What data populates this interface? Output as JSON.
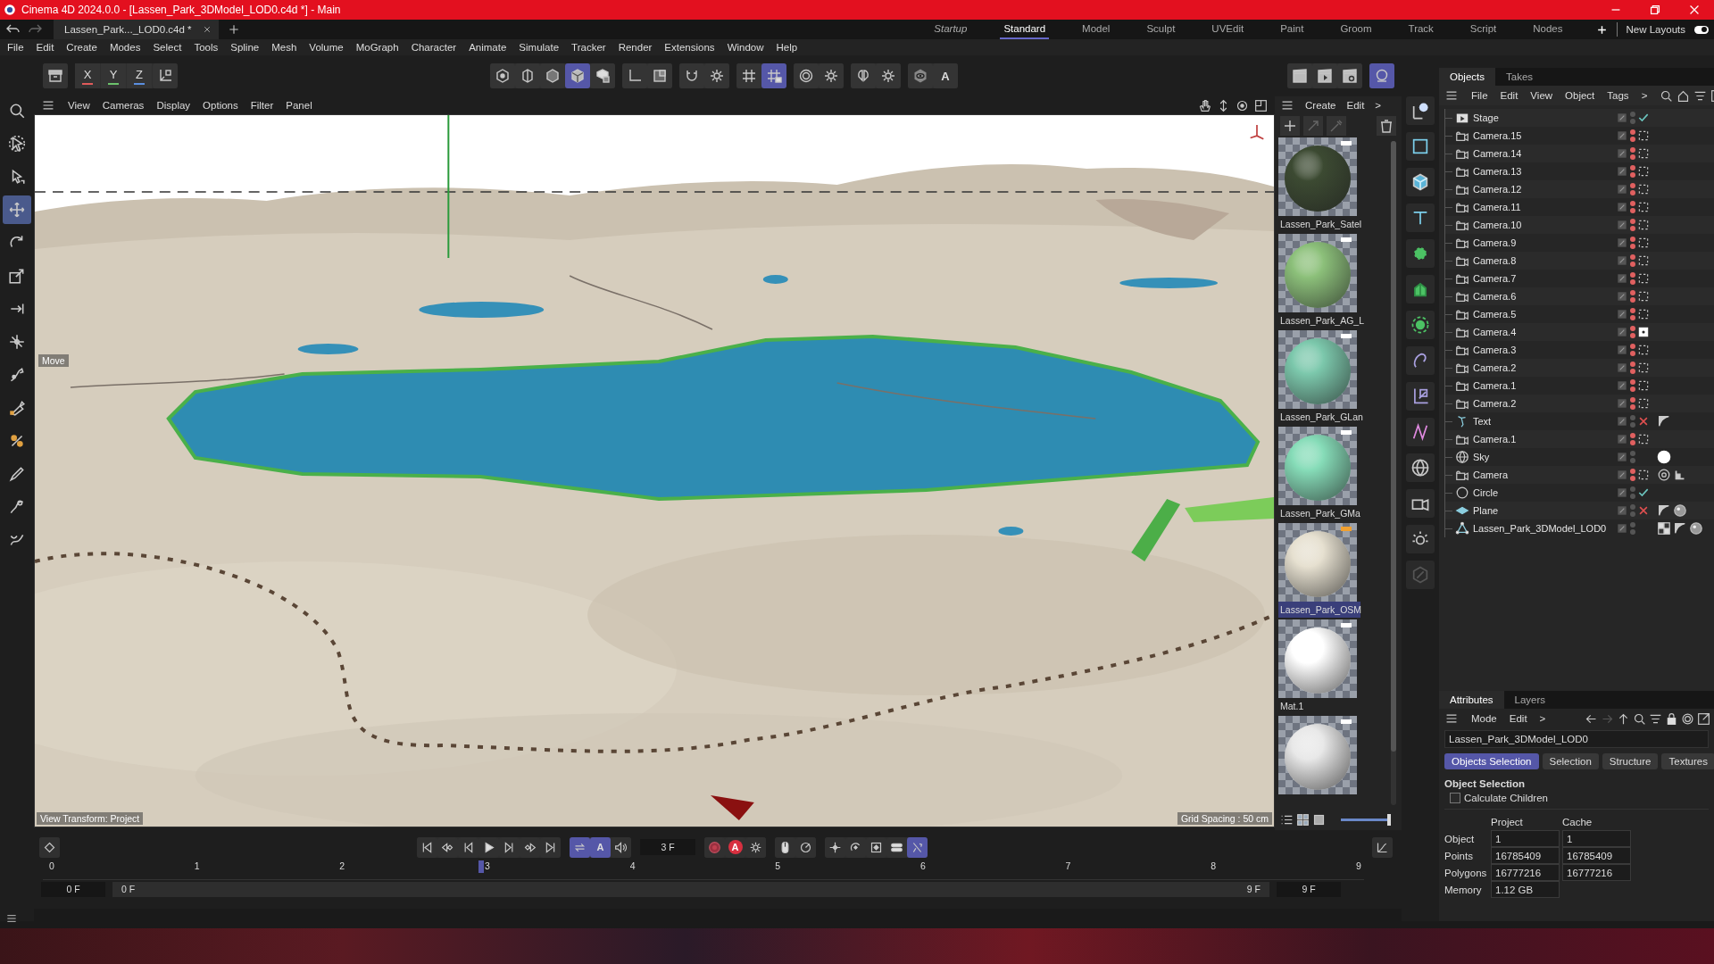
{
  "window": {
    "title": "Cinema 4D 2024.0.0 - [Lassen_Park_3DModel_LOD0.c4d *] - Main"
  },
  "document_tabs": [
    {
      "label": "Lassen_Park..._LOD0.c4d *",
      "selected": true
    }
  ],
  "layout_tabs": [
    {
      "label": "Startup",
      "kind": "startup",
      "selected": false
    },
    {
      "label": "Standard",
      "kind": "layout",
      "selected": true
    },
    {
      "label": "Model",
      "kind": "layout",
      "selected": false
    },
    {
      "label": "Sculpt",
      "kind": "layout",
      "selected": false
    },
    {
      "label": "UVEdit",
      "kind": "layout",
      "selected": false
    },
    {
      "label": "Paint",
      "kind": "layout",
      "selected": false
    },
    {
      "label": "Groom",
      "kind": "layout",
      "selected": false
    },
    {
      "label": "Track",
      "kind": "layout",
      "selected": false
    },
    {
      "label": "Script",
      "kind": "layout",
      "selected": false
    },
    {
      "label": "Nodes",
      "kind": "layout",
      "selected": false
    }
  ],
  "new_layouts": {
    "label": "New Layouts",
    "on": true
  },
  "menu": [
    "File",
    "Edit",
    "Create",
    "Modes",
    "Select",
    "Tools",
    "Spline",
    "Mesh",
    "Volume",
    "MoGraph",
    "Character",
    "Animate",
    "Simulate",
    "Tracker",
    "Render",
    "Extensions",
    "Window",
    "Help"
  ],
  "toolbar": {
    "axes": [
      {
        "label": "X",
        "color": "#e05a5a"
      },
      {
        "label": "Y",
        "color": "#6cc26c"
      },
      {
        "label": "Z",
        "color": "#5a8ee0"
      }
    ],
    "buttons": [
      {
        "active": false
      },
      {
        "active": false
      },
      {
        "active": false
      },
      {
        "active": false
      },
      {
        "active": false
      },
      {
        "active": true
      },
      {
        "active": false
      },
      {
        "active": false
      },
      {
        "active": false
      },
      {
        "active": false
      },
      {
        "active": false
      },
      {
        "active": false
      },
      {
        "active": true
      },
      {
        "active": false
      },
      {
        "active": false
      },
      {
        "active": false
      },
      {
        "active": false
      },
      {
        "active": false
      },
      {
        "active": false,
        "label": "A"
      },
      {
        "active": false
      },
      {
        "active": false
      },
      {
        "active": false
      },
      {
        "active": true
      }
    ]
  },
  "tools": [
    {
      "active": false
    },
    {
      "active": false
    },
    {
      "active": false
    },
    {
      "active": true
    },
    {
      "active": false
    },
    {
      "active": false
    },
    {
      "active": false
    },
    {
      "active": false
    },
    {
      "active": false
    },
    {
      "active": false
    },
    {
      "active": false
    },
    {
      "active": false
    },
    {
      "active": false
    },
    {
      "active": false
    }
  ],
  "viewport": {
    "menu": [
      "View",
      "Cameras",
      "Display",
      "Options",
      "Filter",
      "Panel"
    ],
    "tool_label": "Move",
    "view_transform": "View Transform: Project",
    "grid_spacing": "Grid Spacing : 50 cm"
  },
  "materials": {
    "menu": [
      "Create",
      "Edit",
      ">"
    ],
    "items": [
      {
        "name": "Lassen_Park_Satel",
        "color": "#3c4a32",
        "selected": false
      },
      {
        "name": "Lassen_Park_AG_L",
        "color": "#8cc07a",
        "selected": false
      },
      {
        "name": "Lassen_Park_GLan",
        "color": "#7cc8ac",
        "selected": false
      },
      {
        "name": "Lassen_Park_GMa",
        "color": "#86dcb8",
        "selected": false
      },
      {
        "name": "Lassen_Park_OSM",
        "color": "#e6e0d0",
        "selected": true
      },
      {
        "name": "Mat.1",
        "color": "#ffffff",
        "selected": false
      },
      {
        "color": "#e8e8e8",
        "selected": false
      }
    ],
    "zoom_slider": {
      "level": 1
    }
  },
  "objects": {
    "tabs": [
      {
        "label": "Objects",
        "selected": true
      },
      {
        "label": "Takes",
        "selected": false
      }
    ],
    "menu": [
      "File",
      "Edit",
      "View",
      "Object",
      "Tags",
      ">"
    ],
    "items": [
      {
        "name": "Stage",
        "kind": "stage",
        "hidden": false,
        "enabled": true
      },
      {
        "name": "Camera.15",
        "kind": "camera",
        "hidden": true,
        "active": false
      },
      {
        "name": "Camera.14",
        "kind": "camera",
        "hidden": true,
        "active": false
      },
      {
        "name": "Camera.13",
        "kind": "camera",
        "hidden": true,
        "active": false
      },
      {
        "name": "Camera.12",
        "kind": "camera",
        "hidden": true,
        "active": false
      },
      {
        "name": "Camera.11",
        "kind": "camera",
        "hidden": true,
        "active": false
      },
      {
        "name": "Camera.10",
        "kind": "camera",
        "hidden": true,
        "active": false
      },
      {
        "name": "Camera.9",
        "kind": "camera",
        "hidden": true,
        "active": false
      },
      {
        "name": "Camera.8",
        "kind": "camera",
        "hidden": true,
        "active": false
      },
      {
        "name": "Camera.7",
        "kind": "camera",
        "hidden": true,
        "active": false
      },
      {
        "name": "Camera.6",
        "kind": "camera",
        "hidden": true,
        "active": false
      },
      {
        "name": "Camera.5",
        "kind": "camera",
        "hidden": true,
        "active": false
      },
      {
        "name": "Camera.4",
        "kind": "camera",
        "hidden": true,
        "active": true
      },
      {
        "name": "Camera.3",
        "kind": "camera",
        "hidden": true,
        "active": false
      },
      {
        "name": "Camera.2",
        "kind": "camera",
        "hidden": true,
        "active": false
      },
      {
        "name": "Camera.1",
        "kind": "camera",
        "hidden": true,
        "active": false
      },
      {
        "name": "Camera.2",
        "kind": "camera",
        "hidden": true,
        "active": false
      },
      {
        "name": "Text",
        "kind": "text",
        "hidden": false,
        "enabled": false,
        "tags": [
          {
            "kind": "phong"
          }
        ]
      },
      {
        "name": "Camera.1",
        "kind": "camera",
        "hidden": true,
        "active": false
      },
      {
        "name": "Sky",
        "kind": "sky",
        "hidden": false,
        "tags": [
          {
            "kind": "material-white"
          }
        ]
      },
      {
        "name": "Camera",
        "kind": "camera",
        "hidden": true,
        "active": false,
        "tags": [
          {
            "kind": "target"
          },
          {
            "kind": "protection"
          }
        ]
      },
      {
        "name": "Circle",
        "kind": "circle",
        "hidden": false,
        "enabled": true
      },
      {
        "name": "Plane",
        "kind": "plane",
        "hidden": false,
        "enabled": false,
        "tags": [
          {
            "kind": "phong"
          },
          {
            "kind": "material"
          }
        ]
      },
      {
        "name": "Lassen_Park_3DModel_LOD0",
        "kind": "polygon",
        "hidden": false,
        "tags": [
          {
            "kind": "display"
          },
          {
            "kind": "phong"
          },
          {
            "kind": "material"
          }
        ]
      }
    ]
  },
  "attributes": {
    "tabs": [
      {
        "label": "Attributes",
        "selected": true
      },
      {
        "label": "Layers",
        "selected": false
      }
    ],
    "menu": [
      "Mode",
      "Edit",
      ">"
    ],
    "object_name": "Lassen_Park_3DModel_LOD0",
    "sections": [
      {
        "label": "Objects Selection",
        "selected": true
      },
      {
        "label": "Selection",
        "selected": false
      },
      {
        "label": "Structure",
        "selected": false
      },
      {
        "label": "Textures",
        "selected": false
      }
    ],
    "heading": "Object Selection",
    "calculate_children": {
      "label": "Calculate Children",
      "checked": false
    },
    "columns": [
      "Project",
      "Cache"
    ],
    "rows": [
      {
        "label": "Object",
        "project": "1",
        "cache": "1"
      },
      {
        "label": "Points",
        "project": "16785409",
        "cache": "16785409"
      },
      {
        "label": "Polygons",
        "project": "16777216",
        "cache": "16777216"
      },
      {
        "label": "Memory",
        "project": "1.12 GB"
      }
    ]
  },
  "timeline": {
    "buttons": [
      {
        "active": false
      },
      {
        "active": false
      },
      {
        "active": false
      },
      {
        "active": false
      },
      {
        "active": false
      },
      {
        "active": false
      },
      {
        "active": false
      },
      {
        "active": false
      },
      {
        "active": true
      },
      {
        "active": true,
        "label": "A"
      },
      {
        "active": false
      },
      {
        "active": false
      },
      {
        "active": false,
        "label": "A"
      },
      {
        "active": false
      },
      {
        "active": false
      },
      {
        "active": false
      },
      {
        "active": false
      },
      {
        "active": false
      },
      {
        "active": false
      },
      {
        "active": false
      },
      {
        "active": true
      },
      {
        "active": false
      }
    ],
    "current_frame": "3 F",
    "ruler": [
      "0",
      "1",
      "2",
      "3",
      "4",
      "5",
      "6",
      "7",
      "8",
      "9"
    ],
    "playhead": {
      "level": 0.333
    },
    "start_field": "0 F",
    "range": {
      "start": "0 F",
      "end": "9 F",
      "level": 1
    },
    "end_field": "9 F"
  }
}
